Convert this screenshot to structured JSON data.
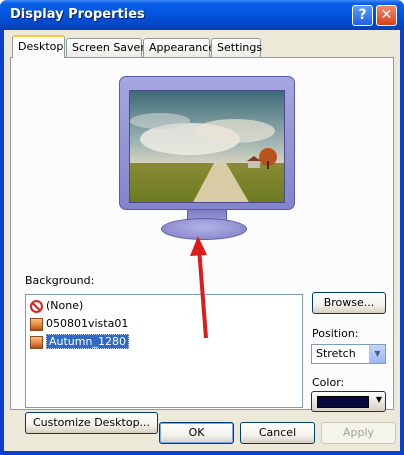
{
  "window": {
    "title": "Display Properties",
    "help_button": "?",
    "close_button": "✕"
  },
  "tabs": [
    {
      "label": "Desktop",
      "active": true
    },
    {
      "label": "Screen Saver",
      "active": false
    },
    {
      "label": "Appearance",
      "active": false
    },
    {
      "label": "Settings",
      "active": false
    }
  ],
  "background": {
    "label": "Background:",
    "items": [
      {
        "label": "(None)",
        "icon": "no-entry-icon"
      },
      {
        "label": "050801vista01",
        "icon": "image-file-icon"
      },
      {
        "label": "Autumn_1280",
        "icon": "image-file-icon",
        "selected": true
      }
    ],
    "browse_label": "Browse..."
  },
  "position": {
    "label": "Position:",
    "value": "Stretch"
  },
  "color": {
    "label": "Color:",
    "swatch": "#06083a"
  },
  "customize_label": "Customize Desktop...",
  "footer": {
    "ok_label": "OK",
    "cancel_label": "Cancel",
    "apply_label": "Apply"
  },
  "colors": {
    "accent_arrow": "#dd1c1c",
    "title_bar": "#0255e0",
    "selection": "#316ac5"
  }
}
